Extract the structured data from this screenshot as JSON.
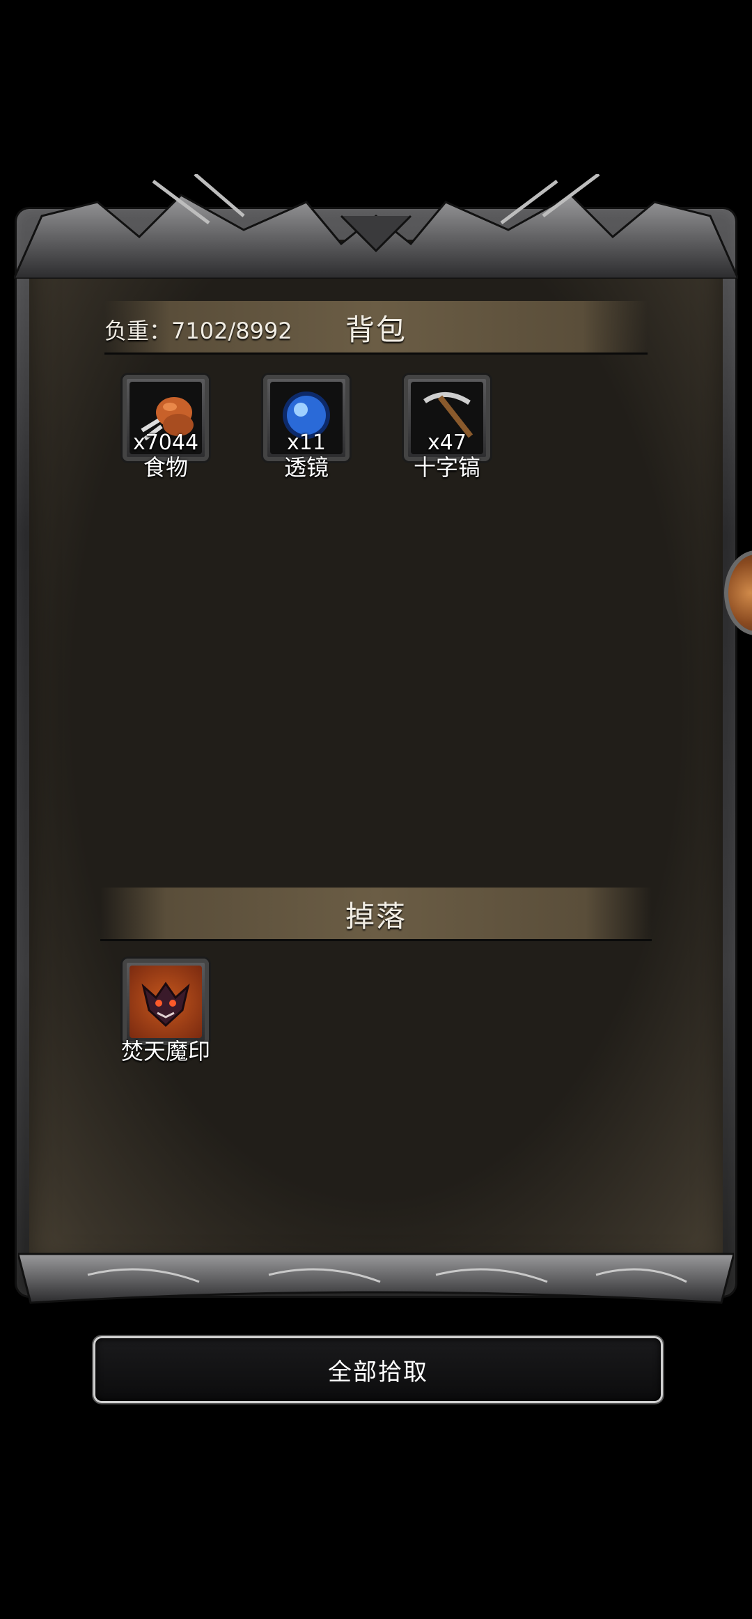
{
  "backpack": {
    "title": "背包",
    "weight_label": "负重：7102/8992",
    "items": [
      {
        "name": "食物",
        "count": "x7044",
        "icon": "drumstick-icon"
      },
      {
        "name": "透镜",
        "count": "x11",
        "icon": "blue-orb-icon"
      },
      {
        "name": "十字镐",
        "count": "x47",
        "icon": "pickaxe-icon"
      }
    ]
  },
  "drops": {
    "title": "掉落",
    "items": [
      {
        "name": "焚天魔印",
        "icon": "demon-seal-icon"
      }
    ]
  },
  "actions": {
    "pickup_all_label": "全部拾取"
  },
  "colors": {
    "panel": "#211e19",
    "header": "#6b5d45",
    "text": "#f1ede4"
  }
}
